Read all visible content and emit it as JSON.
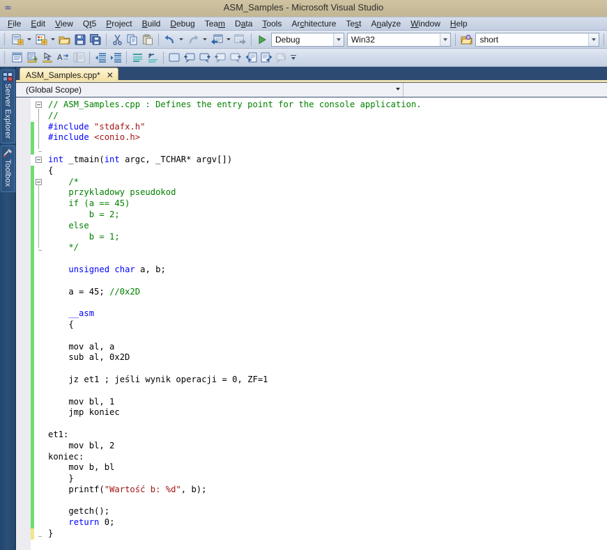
{
  "window": {
    "title": "ASM_Samples - Microsoft Visual Studio",
    "logo_icon": "visual-studio-logo"
  },
  "menubar": {
    "items": [
      {
        "label": "File",
        "accel": "F"
      },
      {
        "label": "Edit",
        "accel": "E"
      },
      {
        "label": "View",
        "accel": "V"
      },
      {
        "label": "Qt5",
        "accel": "t"
      },
      {
        "label": "Project",
        "accel": "P"
      },
      {
        "label": "Build",
        "accel": "B"
      },
      {
        "label": "Debug",
        "accel": "D"
      },
      {
        "label": "Team",
        "accel": "m"
      },
      {
        "label": "Data",
        "accel": "a"
      },
      {
        "label": "Tools",
        "accel": "T"
      },
      {
        "label": "Architecture",
        "accel": "c"
      },
      {
        "label": "Test",
        "accel": "s"
      },
      {
        "label": "Analyze",
        "accel": "n"
      },
      {
        "label": "Window",
        "accel": "W"
      },
      {
        "label": "Help",
        "accel": "H"
      }
    ]
  },
  "toolbar_standard": {
    "buttons": [
      {
        "name": "new-project-button",
        "icon": "new-project-icon"
      },
      {
        "name": "new-project-dropdown",
        "icon": "chevron-down-icon"
      },
      {
        "name": "add-new-item-button",
        "icon": "add-new-item-icon"
      },
      {
        "name": "add-new-item-dropdown",
        "icon": "chevron-down-icon"
      },
      {
        "name": "open-file-button",
        "icon": "open-folder-icon"
      },
      {
        "name": "save-button",
        "icon": "save-icon"
      },
      {
        "name": "save-all-button",
        "icon": "save-all-icon"
      },
      {
        "name": "cut-button",
        "icon": "scissors-icon"
      },
      {
        "name": "copy-button",
        "icon": "copy-icon"
      },
      {
        "name": "paste-button",
        "icon": "paste-icon"
      },
      {
        "name": "undo-button",
        "icon": "undo-arrow-icon"
      },
      {
        "name": "undo-dropdown",
        "icon": "chevron-down-icon"
      },
      {
        "name": "redo-button",
        "icon": "redo-arrow-icon"
      },
      {
        "name": "redo-dropdown",
        "icon": "chevron-down-icon"
      },
      {
        "name": "navigate-backward-button",
        "icon": "navigate-backward-icon"
      },
      {
        "name": "navigate-backward-dropdown",
        "icon": "chevron-down-icon"
      },
      {
        "name": "navigate-forward-button",
        "icon": "navigate-forward-icon"
      },
      {
        "name": "start-debugging-button",
        "icon": "green-play-icon"
      }
    ],
    "config_combo": {
      "value": "Debug",
      "name": "solution-configuration-combo"
    },
    "platform_combo": {
      "value": "Win32",
      "name": "solution-platform-combo"
    },
    "find_icon": "find-in-files-icon",
    "find_combo": {
      "value": "short",
      "name": "find-combo"
    }
  },
  "toolbar_text_editor": {
    "buttons": [
      {
        "name": "display-class-view-button",
        "icon": "class-view-icon"
      },
      {
        "name": "insert-snippet-button",
        "icon": "insert-snippet-icon"
      },
      {
        "name": "surround-with-button",
        "icon": "surround-with-icon"
      },
      {
        "name": "toggle-word-wrap-button",
        "icon": "word-wrap-icon"
      },
      {
        "name": "comment-block-button",
        "icon": "comment-lines-icon"
      },
      {
        "name": "decrease-indent-button",
        "icon": "decrease-indent-icon"
      },
      {
        "name": "increase-indent-button",
        "icon": "increase-indent-icon"
      },
      {
        "name": "comment-selection-button",
        "icon": "comment-selection-icon"
      },
      {
        "name": "uncomment-selection-button",
        "icon": "uncomment-selection-icon"
      },
      {
        "name": "toggle-bookmark-button",
        "icon": "bookmark-blank-icon"
      },
      {
        "name": "previous-bookmark-button",
        "icon": "bookmark-previous-icon"
      },
      {
        "name": "next-bookmark-button",
        "icon": "bookmark-next-icon"
      },
      {
        "name": "previous-bookmark-folder-button",
        "icon": "bookmark-prev-folder-icon"
      },
      {
        "name": "next-bookmark-folder-button",
        "icon": "bookmark-next-folder-icon"
      },
      {
        "name": "previous-bookmark-document-button",
        "icon": "bookmark-prev-doc-icon"
      },
      {
        "name": "next-bookmark-document-button",
        "icon": "bookmark-next-doc-icon"
      },
      {
        "name": "clear-bookmarks-button",
        "icon": "clear-bookmarks-icon"
      }
    ]
  },
  "sidebar": {
    "tabs": [
      {
        "label": "Server Explorer",
        "icon": "server-explorer-icon",
        "name": "sidebar-tab-server-explorer"
      },
      {
        "label": "Toolbox",
        "icon": "toolbox-icon",
        "name": "sidebar-tab-toolbox"
      }
    ]
  },
  "document": {
    "tab_label": "ASM_Samples.cpp*",
    "close_glyph": "✕",
    "navbar": {
      "scope_value": "(Global Scope)"
    }
  },
  "code": {
    "lines": [
      {
        "fold": "open",
        "change": "none",
        "tokens": [
          {
            "t": "// ASM_Samples.cpp : Defines the entry point for the console application.",
            "c": "c-com"
          }
        ]
      },
      {
        "fold": "none",
        "change": "none",
        "tokens": [
          {
            "t": "//",
            "c": "c-com"
          }
        ]
      },
      {
        "fold": "none",
        "change": "green",
        "tokens": [
          {
            "t": "#include",
            "c": "c-pre"
          },
          {
            "t": " ",
            "c": "c-plain"
          },
          {
            "t": "\"stdafx.h\"",
            "c": "c-inc"
          }
        ]
      },
      {
        "fold": "none",
        "change": "green",
        "tokens": [
          {
            "t": "#include",
            "c": "c-pre"
          },
          {
            "t": " ",
            "c": "c-plain"
          },
          {
            "t": "<conio.h>",
            "c": "c-inc"
          }
        ]
      },
      {
        "fold": "end",
        "change": "green",
        "tokens": []
      },
      {
        "fold": "open",
        "change": "none",
        "tokens": [
          {
            "t": "int",
            "c": "c-kw"
          },
          {
            "t": " _tmain(",
            "c": "c-plain"
          },
          {
            "t": "int",
            "c": "c-kw"
          },
          {
            "t": " argc, _TCHAR* argv[])",
            "c": "c-plain"
          }
        ]
      },
      {
        "fold": "none",
        "change": "green",
        "tokens": [
          {
            "t": "{",
            "c": "c-plain"
          }
        ]
      },
      {
        "fold": "open",
        "change": "green",
        "tokens": [
          {
            "t": "    /*",
            "c": "c-com"
          }
        ]
      },
      {
        "fold": "none",
        "change": "green",
        "tokens": [
          {
            "t": "    przykladowy pseudokod",
            "c": "c-com"
          }
        ]
      },
      {
        "fold": "none",
        "change": "green",
        "tokens": [
          {
            "t": "    if (a == 45)",
            "c": "c-com"
          }
        ]
      },
      {
        "fold": "none",
        "change": "green",
        "tokens": [
          {
            "t": "        b = 2;",
            "c": "c-com"
          }
        ]
      },
      {
        "fold": "none",
        "change": "green",
        "tokens": [
          {
            "t": "    else",
            "c": "c-com"
          }
        ]
      },
      {
        "fold": "none",
        "change": "green",
        "tokens": [
          {
            "t": "        b = 1;",
            "c": "c-com"
          }
        ]
      },
      {
        "fold": "end",
        "change": "green",
        "tokens": [
          {
            "t": "    */",
            "c": "c-com"
          }
        ]
      },
      {
        "fold": "none",
        "change": "green",
        "tokens": []
      },
      {
        "fold": "none",
        "change": "green",
        "tokens": [
          {
            "t": "    ",
            "c": "c-plain"
          },
          {
            "t": "unsigned",
            "c": "c-kw"
          },
          {
            "t": " ",
            "c": "c-plain"
          },
          {
            "t": "char",
            "c": "c-kw"
          },
          {
            "t": " a, b;",
            "c": "c-plain"
          }
        ]
      },
      {
        "fold": "none",
        "change": "green",
        "tokens": []
      },
      {
        "fold": "none",
        "change": "green",
        "tokens": [
          {
            "t": "    a = 45; ",
            "c": "c-plain"
          },
          {
            "t": "//0x2D",
            "c": "c-com"
          }
        ]
      },
      {
        "fold": "none",
        "change": "green",
        "tokens": []
      },
      {
        "fold": "none",
        "change": "green",
        "tokens": [
          {
            "t": "    ",
            "c": "c-plain"
          },
          {
            "t": "__asm",
            "c": "c-kw"
          }
        ]
      },
      {
        "fold": "none",
        "change": "green",
        "tokens": [
          {
            "t": "    {",
            "c": "c-plain"
          }
        ]
      },
      {
        "fold": "none",
        "change": "green",
        "tokens": []
      },
      {
        "fold": "none",
        "change": "green",
        "tokens": [
          {
            "t": "    mov al, a",
            "c": "c-plain"
          }
        ]
      },
      {
        "fold": "none",
        "change": "green",
        "tokens": [
          {
            "t": "    sub al, 0x2D",
            "c": "c-plain"
          }
        ]
      },
      {
        "fold": "none",
        "change": "green",
        "tokens": []
      },
      {
        "fold": "none",
        "change": "green",
        "tokens": [
          {
            "t": "    jz et1 ; jeśli wynik operacji = 0, ZF=1",
            "c": "c-plain"
          }
        ]
      },
      {
        "fold": "none",
        "change": "green",
        "tokens": []
      },
      {
        "fold": "none",
        "change": "green",
        "tokens": [
          {
            "t": "    mov bl, 1",
            "c": "c-plain"
          }
        ]
      },
      {
        "fold": "none",
        "change": "green",
        "tokens": [
          {
            "t": "    jmp koniec",
            "c": "c-plain"
          }
        ]
      },
      {
        "fold": "none",
        "change": "green",
        "tokens": []
      },
      {
        "fold": "none",
        "change": "green",
        "tokens": [
          {
            "t": "et1:",
            "c": "c-plain"
          }
        ]
      },
      {
        "fold": "none",
        "change": "green",
        "tokens": [
          {
            "t": "    mov bl, 2",
            "c": "c-plain"
          }
        ]
      },
      {
        "fold": "none",
        "change": "green",
        "tokens": [
          {
            "t": "koniec:",
            "c": "c-plain"
          }
        ]
      },
      {
        "fold": "none",
        "change": "green",
        "tokens": [
          {
            "t": "    mov b, bl",
            "c": "c-plain"
          }
        ]
      },
      {
        "fold": "none",
        "change": "green",
        "tokens": [
          {
            "t": "    }",
            "c": "c-plain"
          }
        ]
      },
      {
        "fold": "none",
        "change": "green",
        "tokens": [
          {
            "t": "    printf(",
            "c": "c-plain"
          },
          {
            "t": "\"Wartość b: %d\"",
            "c": "c-str"
          },
          {
            "t": ", b);",
            "c": "c-plain"
          }
        ]
      },
      {
        "fold": "none",
        "change": "green",
        "tokens": []
      },
      {
        "fold": "none",
        "change": "green",
        "tokens": [
          {
            "t": "    getch();",
            "c": "c-plain"
          }
        ]
      },
      {
        "fold": "none",
        "change": "green",
        "tokens": [
          {
            "t": "    ",
            "c": "c-plain"
          },
          {
            "t": "return",
            "c": "c-kw"
          },
          {
            "t": " 0;",
            "c": "c-plain"
          }
        ]
      },
      {
        "fold": "end",
        "change": "yellow",
        "tokens": [
          {
            "t": "}",
            "c": "c-plain"
          }
        ]
      }
    ]
  },
  "colors": {
    "title_bar": "#c7bb99",
    "menu_bar": "#c9d4e5",
    "tabstrip": "#2c4a72",
    "active_tab": "#f7e9b6",
    "change_green": "#6fdd6f",
    "change_yellow": "#f2e58a",
    "editor_bg": "#ffffff",
    "indicator_margin": "#ebebf0"
  }
}
